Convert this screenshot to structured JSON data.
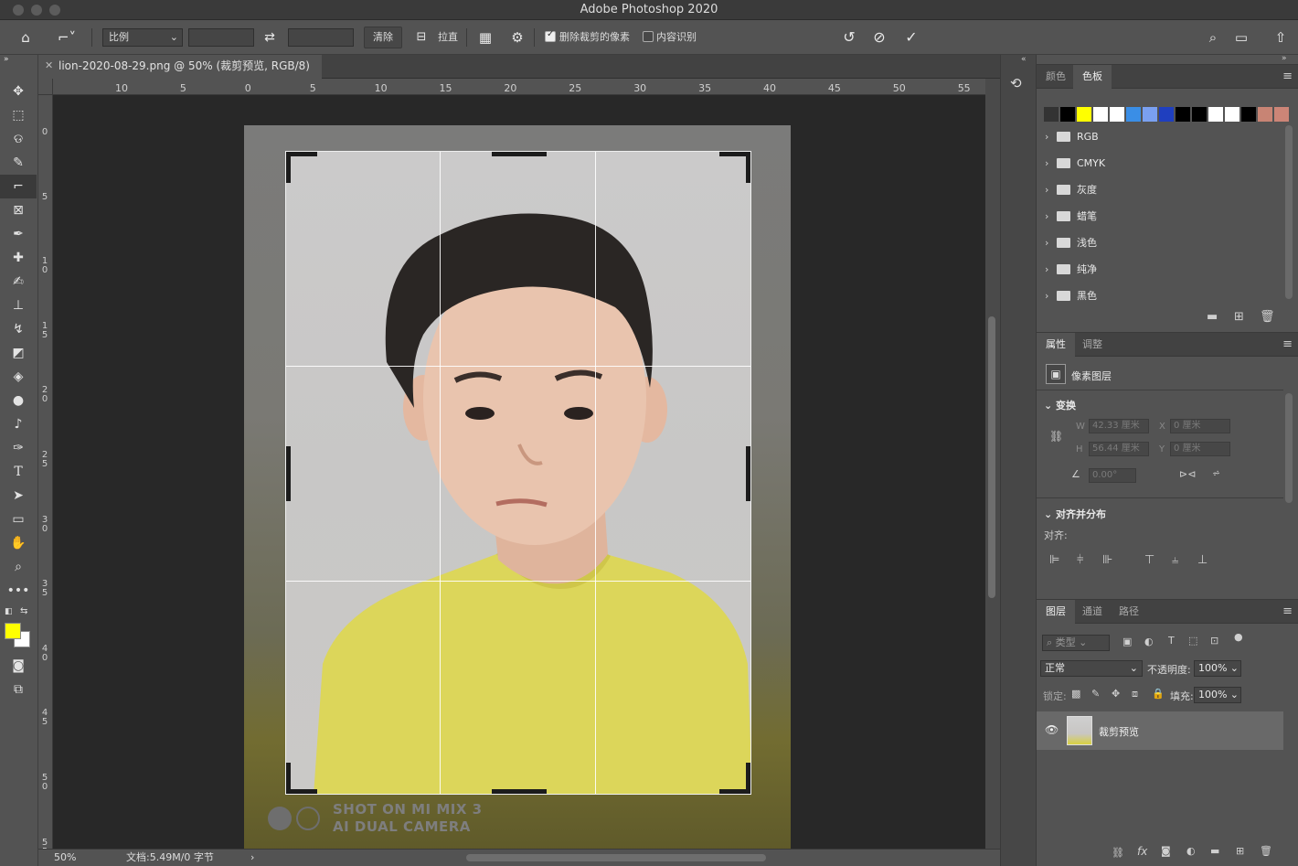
{
  "window": {
    "title": "Adobe Photoshop 2020"
  },
  "options_bar": {
    "ratio_select": "比例",
    "clear_button": "清除",
    "straighten_label": "拉直",
    "delete_cropped_label": "删除裁剪的像素",
    "delete_cropped_checked": true,
    "content_aware_label": "内容识别",
    "content_aware_checked": false
  },
  "document": {
    "tab_title": "lion-2020-08-29.png @ 50% (裁剪预览, RGB/8)",
    "zoom": "50%",
    "doc_info": "文档:5.49M/0 字节",
    "watermark_line1": "SHOT ON MI MIX 3",
    "watermark_line2": "AI DUAL CAMERA"
  },
  "ruler": {
    "h_ticks": [
      "10",
      "5",
      "0",
      "5",
      "10",
      "15",
      "20",
      "25",
      "30",
      "35",
      "40",
      "45",
      "50",
      "55"
    ],
    "v_ticks": [
      "0",
      "5",
      "10",
      "15",
      "20",
      "25",
      "30",
      "35",
      "40",
      "45",
      "50",
      "55"
    ]
  },
  "swatches_panel": {
    "tabs": [
      "颜色",
      "色板"
    ],
    "active_tab": "色板",
    "colors": [
      "#333333",
      "#000000",
      "#ffff00",
      "#ffffff",
      "#ffffff",
      "#3a8ee6",
      "#7aa0f0",
      "#1f3fbf",
      "#000000",
      "#000000",
      "#ffffff",
      "#ffffff",
      "#000000",
      "#c88474",
      "#cc8577"
    ],
    "groups": [
      "RGB",
      "CMYK",
      "灰度",
      "蜡笔",
      "浅色",
      "纯净",
      "黑色"
    ]
  },
  "properties_panel": {
    "tabs": [
      "属性",
      "调整"
    ],
    "active_tab": "属性",
    "layer_type": "像素图层",
    "transform_title": "变换",
    "w_label": "W",
    "w_value": "42.33 厘米",
    "h_label": "H",
    "h_value": "56.44 厘米",
    "x_label": "X",
    "x_value": "0 厘米",
    "y_label": "Y",
    "y_value": "0 厘米",
    "angle_value": "0.00°",
    "align_title": "对齐并分布",
    "align_label": "对齐:"
  },
  "layers_panel": {
    "tabs": [
      "图层",
      "通道",
      "路径"
    ],
    "active_tab": "图层",
    "filter_placeholder": "类型",
    "blend_mode": "正常",
    "opacity_label": "不透明度:",
    "opacity_value": "100%",
    "lock_label": "锁定:",
    "fill_label": "填充:",
    "fill_value": "100%",
    "layers": [
      {
        "name": "裁剪预览",
        "visible": true
      }
    ]
  },
  "colors": {
    "foreground": "#ffff00",
    "background": "#ffffff"
  }
}
